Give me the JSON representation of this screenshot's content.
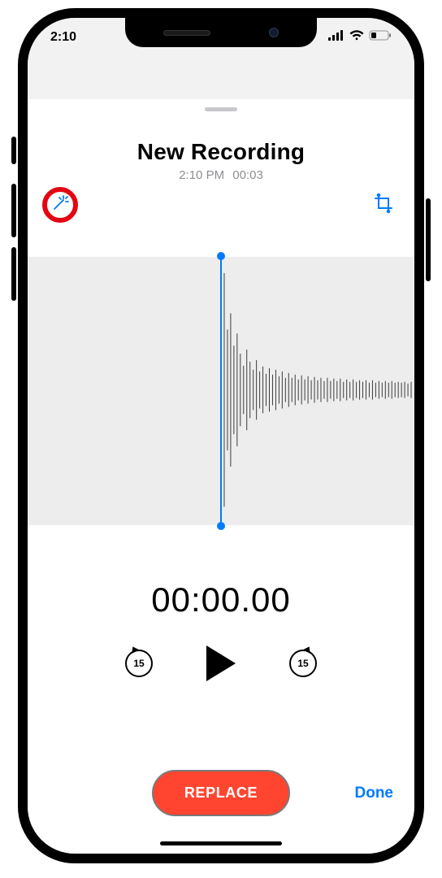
{
  "status": {
    "time": "2:10"
  },
  "recording": {
    "title": "New Recording",
    "timestamp": "2:10 PM",
    "duration": "00:03"
  },
  "playhead": {
    "timer": "00:00.00"
  },
  "controls": {
    "skip_interval": "15",
    "replace_label": "REPLACE",
    "done_label": "Done"
  },
  "colors": {
    "accent": "#007aff",
    "danger": "#ff4530",
    "highlight": "#e30613"
  }
}
